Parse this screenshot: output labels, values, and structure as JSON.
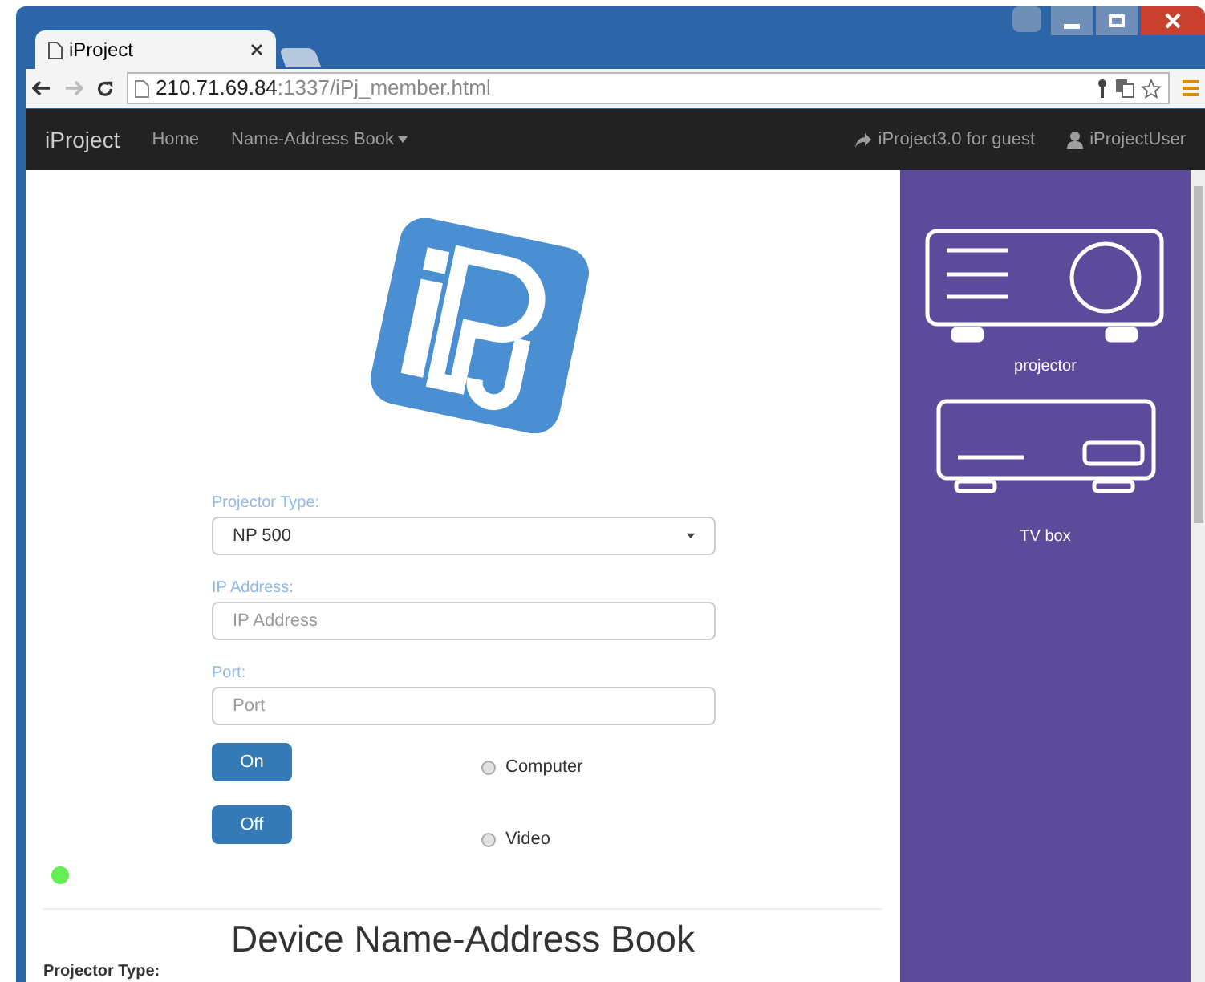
{
  "browser": {
    "tabs": [
      {
        "title": "iProject",
        "selected": true
      }
    ],
    "url_host": "210.71.69.84",
    "url_path": ":1337/iPj_member.html"
  },
  "navbar": {
    "brand": "iProject",
    "items": [
      {
        "label": "Home",
        "dropdown": false
      },
      {
        "label": "Name-Address Book",
        "dropdown": true
      }
    ],
    "right_items": [
      {
        "label": "iProject3.0 for guest",
        "kind": "share"
      },
      {
        "label": "iProjectUser",
        "kind": "user"
      }
    ]
  },
  "form": {
    "projector_type": {
      "label": "Projector Type:",
      "value": "NP 500"
    },
    "ip_address": {
      "label": "IP Address:",
      "placeholder": "IP Address"
    },
    "port": {
      "label": "Port:",
      "placeholder": "Port"
    },
    "buttons": [
      "On",
      "Off"
    ],
    "sources": [
      {
        "label": "Computer",
        "selected": false
      },
      {
        "label": "Video",
        "selected": false
      }
    ]
  },
  "status_light": {
    "on": true,
    "color": "#66ee55"
  },
  "section_title": "Device Name-Address Book",
  "section_label": "Projector Type:",
  "devices": [
    {
      "label": "projector",
      "kind": "projector"
    },
    {
      "label": "TV box",
      "kind": "tvbox"
    }
  ]
}
